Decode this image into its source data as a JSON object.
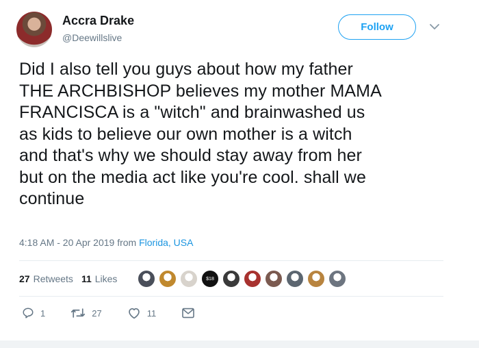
{
  "user": {
    "name": "Accra Drake",
    "handle": "@Deewillslive"
  },
  "follow_label": "Follow",
  "tweet": {
    "text_lines": [
      "Did I also tell you guys about how my father",
      "THE ARCHBISHOP believes my mother MAMA",
      "FRANCISCA is a \"witch\" and brainwashed us",
      "as kids to believe our own mother is a witch",
      "and that's why we should stay away from her",
      "but on the media act like you're cool. shall we",
      "continue"
    ],
    "timestamp": "4:18 AM - 20 Apr 2019 from ",
    "location": "Florida, USA"
  },
  "stats": {
    "retweets_count": "27",
    "retweets_label": "Retweets",
    "likes_count": "11",
    "likes_label": "Likes"
  },
  "likers": {
    "colors": [
      "#4a4f5a",
      "#c0892e",
      "#d8d3cc",
      "#111111",
      "#3a3a3a",
      "#a8322f",
      "#7b5a50",
      "#5c6670",
      "#b8843f",
      "#6d7580"
    ],
    "badge_text": "$18"
  },
  "actions": {
    "reply_count": "1",
    "retweet_count": "27",
    "like_count": "11"
  },
  "colors": {
    "accent": "#1da1f2",
    "link": "#1b95e0",
    "secondary_text": "#657786"
  }
}
